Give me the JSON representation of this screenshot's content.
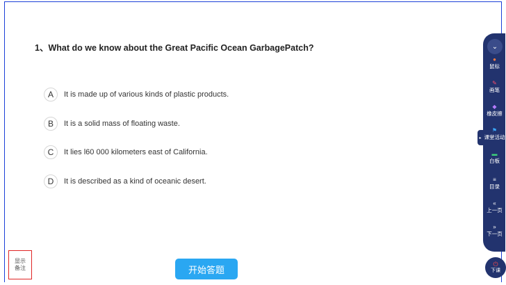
{
  "question": {
    "text": "1、What do we know about the Great Pacific Ocean GarbagePatch?"
  },
  "options": [
    {
      "letter": "A",
      "text": "It is made up of various kinds of plastic products."
    },
    {
      "letter": "B",
      "text": "It is a solid mass of floating waste."
    },
    {
      "letter": "C",
      "text": "It lies l60 000 kilometers east of California."
    },
    {
      "letter": "D",
      "text": "It is described as a kind of oceanic desert."
    }
  ],
  "notes_button": {
    "line1": "显示",
    "line2": "备注"
  },
  "start_button": {
    "label": "开始答题"
  },
  "toolbar": {
    "collapse_glyph": "⌄",
    "items": [
      {
        "label": "鼠标",
        "icon": "mouse-icon",
        "glyph": "●",
        "color": "#ff7a3d"
      },
      {
        "label": "画笔",
        "icon": "pen-icon",
        "glyph": "✎",
        "color": "#ff4d6a"
      },
      {
        "label": "橡皮擦",
        "icon": "eraser-icon",
        "glyph": "◆",
        "color": "#b67cff"
      },
      {
        "label": "课堂活动",
        "icon": "flag-icon",
        "glyph": "⚑",
        "color": "#3aa8ff"
      },
      {
        "label": "白板",
        "icon": "whiteboard-icon",
        "glyph": "▬",
        "color": "#3ed27a"
      },
      {
        "label": "目录",
        "icon": "list-icon",
        "glyph": "≡",
        "color": "#ffffff"
      },
      {
        "label": "上一页",
        "icon": "prev-page-icon",
        "glyph": "«",
        "color": "#ffffff"
      },
      {
        "label": "下一页",
        "icon": "next-page-icon",
        "glyph": "»",
        "color": "#ffffff"
      }
    ],
    "handle_glyph": "▸"
  },
  "end_class_button": {
    "label": "下课",
    "glyph": "⏻"
  }
}
